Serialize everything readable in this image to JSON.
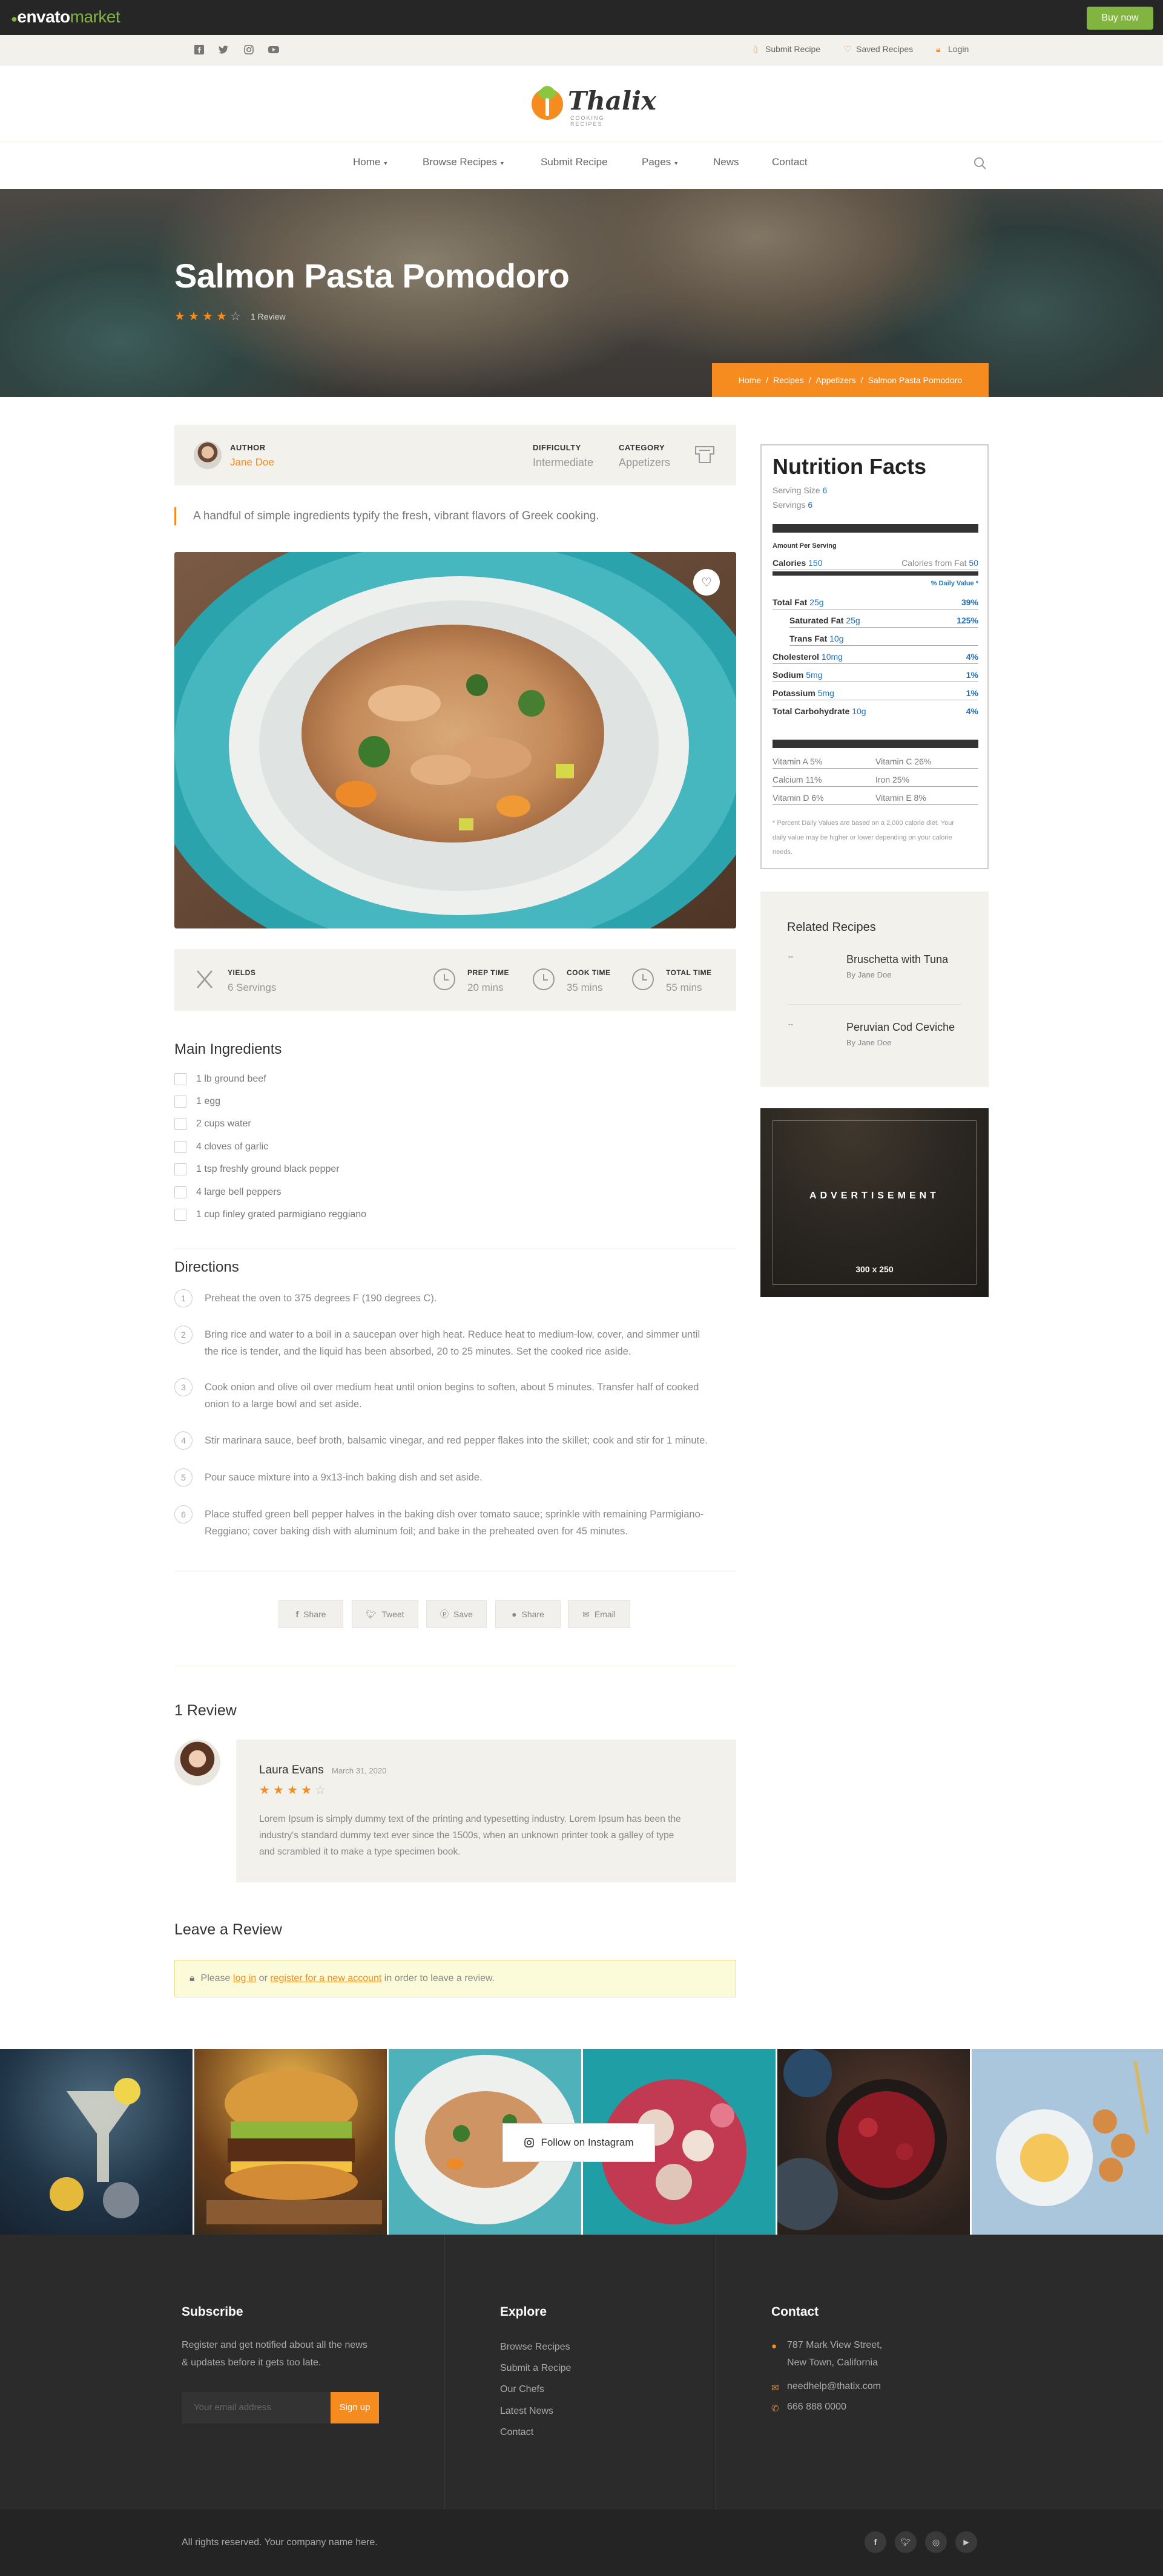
{
  "envato": {
    "logo_bold": "envato",
    "logo_rest": "market",
    "buy_label": "Buy now"
  },
  "topbar": {
    "social": [
      "facebook-icon",
      "twitter-icon",
      "instagram-icon",
      "youtube-icon"
    ],
    "links": [
      {
        "label": "Submit Recipe",
        "icon": "submit-icon"
      },
      {
        "label": "Saved Recipes",
        "icon": "heart-icon"
      },
      {
        "label": "Login",
        "icon": "lock-icon"
      }
    ]
  },
  "brand": {
    "name": "Thalix",
    "tagline": "COOKING RECIPES"
  },
  "nav": {
    "items": [
      {
        "label": "Home",
        "dropdown": "▾"
      },
      {
        "label": "Browse Recipes",
        "dropdown": "▾"
      },
      {
        "label": "Submit Recipe",
        "dropdown": ""
      },
      {
        "label": "Pages",
        "dropdown": "▾"
      },
      {
        "label": "News",
        "dropdown": ""
      },
      {
        "label": "Contact",
        "dropdown": ""
      }
    ]
  },
  "hero": {
    "title": "Salmon Pasta Pomodoro",
    "rating": 4,
    "review_count": "1 Review",
    "breadcrumb": [
      "Home",
      "/",
      "Recipes",
      "/",
      "Appetizers",
      "/",
      "Salmon Pasta Pomodoro"
    ]
  },
  "meta": {
    "author_label": "AUTHOR",
    "author": "Jane Doe",
    "difficulty_label": "DIFFICULTY",
    "difficulty": "Intermediate",
    "category_label": "CATEGORY",
    "category": "Appetizers"
  },
  "quote": "A handful of simple ingredients typify the fresh, vibrant flavors of Greek cooking.",
  "times": {
    "yields_label": "YIELDS",
    "yields": "6 Servings",
    "prep_label": "PREP TIME",
    "prep": "20 mins",
    "cook_label": "COOK TIME",
    "cook": "35 mins",
    "total_label": "TOTAL TIME",
    "total": "55 mins"
  },
  "ingredients": {
    "title": "Main Ingredients",
    "items": [
      "1 lb ground beef",
      "1 egg",
      "2 cups water",
      "4 cloves of garlic",
      "1 tsp freshly ground black pepper",
      "4 large bell peppers",
      "1 cup finley grated parmigiano reggiano"
    ]
  },
  "directions": {
    "title": "Directions",
    "steps": [
      {
        "n": "1",
        "l1": "Preheat the oven to 375 degrees F (190 degrees C).",
        "l2": ""
      },
      {
        "n": "2",
        "l1": "Bring rice and water to a boil in a saucepan over high heat. Reduce heat to medium-low, cover, and simmer until",
        "l2": "the rice is tender, and the liquid has been absorbed, 20 to 25 minutes. Set the cooked rice aside."
      },
      {
        "n": "3",
        "l1": "Cook onion and olive oil over medium heat until onion begins to soften, about 5 minutes. Transfer half of cooked",
        "l2": "onion to a large bowl and set aside."
      },
      {
        "n": "4",
        "l1": "Stir marinara sauce, beef broth, balsamic vinegar, and red pepper flakes into the skillet; cook and stir for 1 minute.",
        "l2": ""
      },
      {
        "n": "5",
        "l1": "Pour sauce mixture into a 9x13-inch baking dish and set aside.",
        "l2": ""
      },
      {
        "n": "6",
        "l1": "Place stuffed green bell pepper halves in the baking dish over tomato sauce; sprinkle with remaining Parmigiano-",
        "l2": "Reggiano; cover baking dish with aluminum foil; and bake in the preheated oven for 45 minutes."
      }
    ]
  },
  "share": [
    {
      "label": "Share",
      "icon": "facebook-icon"
    },
    {
      "label": "Tweet",
      "icon": "twitter-icon"
    },
    {
      "label": "Save",
      "icon": "pinterest-icon"
    },
    {
      "label": "Share",
      "icon": "reddit-icon"
    },
    {
      "label": "Email",
      "icon": "email-icon"
    }
  ],
  "reviews": {
    "title": "1 Review",
    "items": [
      {
        "name": "Laura Evans",
        "date": "March 31, 2020",
        "rating": 4,
        "l1": "Lorem Ipsum is simply dummy text of the printing and typesetting industry. Lorem Ipsum has been the",
        "l2": "industry's standard dummy text ever since the 1500s, when an unknown printer took a galley of type",
        "l3": "and scrambled it to make a type specimen book."
      }
    ]
  },
  "leave": {
    "title": "Leave a Review",
    "pre": "Please ",
    "login": "log in",
    "mid": " or ",
    "register": "register for a new account",
    "post": " in order to leave a review."
  },
  "nutrition": {
    "title": "Nutrition Facts",
    "serving_size_label": "Serving Size",
    "serving_size": "6",
    "servings_label": "Servings",
    "servings": "6",
    "amount_label": "Amount Per Serving",
    "calories_label": "Calories",
    "calories": "150",
    "from_fat_label": "Calories from Fat",
    "from_fat": "50",
    "dv_label": "% Daily Value *",
    "rows": [
      {
        "label": "Total Fat",
        "val": "25g",
        "pct": "39%"
      },
      {
        "label": "Saturated Fat",
        "val": "25g",
        "pct": "125%"
      },
      {
        "label": "Trans Fat",
        "val": "10g",
        "pct": ""
      },
      {
        "label": "Cholesterol",
        "val": "10mg",
        "pct": "4%"
      },
      {
        "label": "Sodium",
        "val": "5mg",
        "pct": "1%"
      },
      {
        "label": "Potassium",
        "val": "5mg",
        "pct": "1%"
      },
      {
        "label": "Total Carbohydrate",
        "val": "10g",
        "pct": "4%"
      }
    ],
    "vitamins": [
      [
        "Vitamin A 5%",
        "Vitamin C 26%"
      ],
      [
        "Calcium 11%",
        "Iron 25%"
      ],
      [
        "Vitamin D 6%",
        "Vitamin E 8%"
      ]
    ],
    "note1": "* Percent Daily Values are based on a 2,000 calorie diet. Your",
    "note2": "daily value may be higher or lower depending on your calorie",
    "note3": "needs."
  },
  "related": {
    "title": "Related Recipes",
    "items": [
      {
        "name": "Bruschetta with Tuna",
        "by": "By Jane Doe",
        "thumb": "--"
      },
      {
        "name": "Peruvian Cod Ceviche",
        "by": "By Jane Doe",
        "thumb": "--"
      }
    ]
  },
  "ad": {
    "label": "ADVERTISEMENT",
    "size": "300 x 250"
  },
  "instagram": {
    "button": "Follow on Instagram"
  },
  "footer": {
    "subscribe_title": "Subscribe",
    "subscribe_l1": "Register and get notified about all the news",
    "subscribe_l2": "& updates before it gets too late.",
    "email_placeholder": "Your email address",
    "signup": "Sign up",
    "explore_title": "Explore",
    "explore": [
      "Browse Recipes",
      "Submit a Recipe",
      "Our Chefs",
      "Latest News",
      "Contact"
    ],
    "contact_title": "Contact",
    "address_l1": "787 Mark View Street,",
    "address_l2": "New Town, California",
    "email": "needhelp@thatix.com",
    "phone": "666 888 0000",
    "copyright": "All rights reserved. Your company name here."
  },
  "colors": {
    "accent": "#f68b1f",
    "envato_green": "#81b441",
    "link_blue": "#1e73be"
  }
}
